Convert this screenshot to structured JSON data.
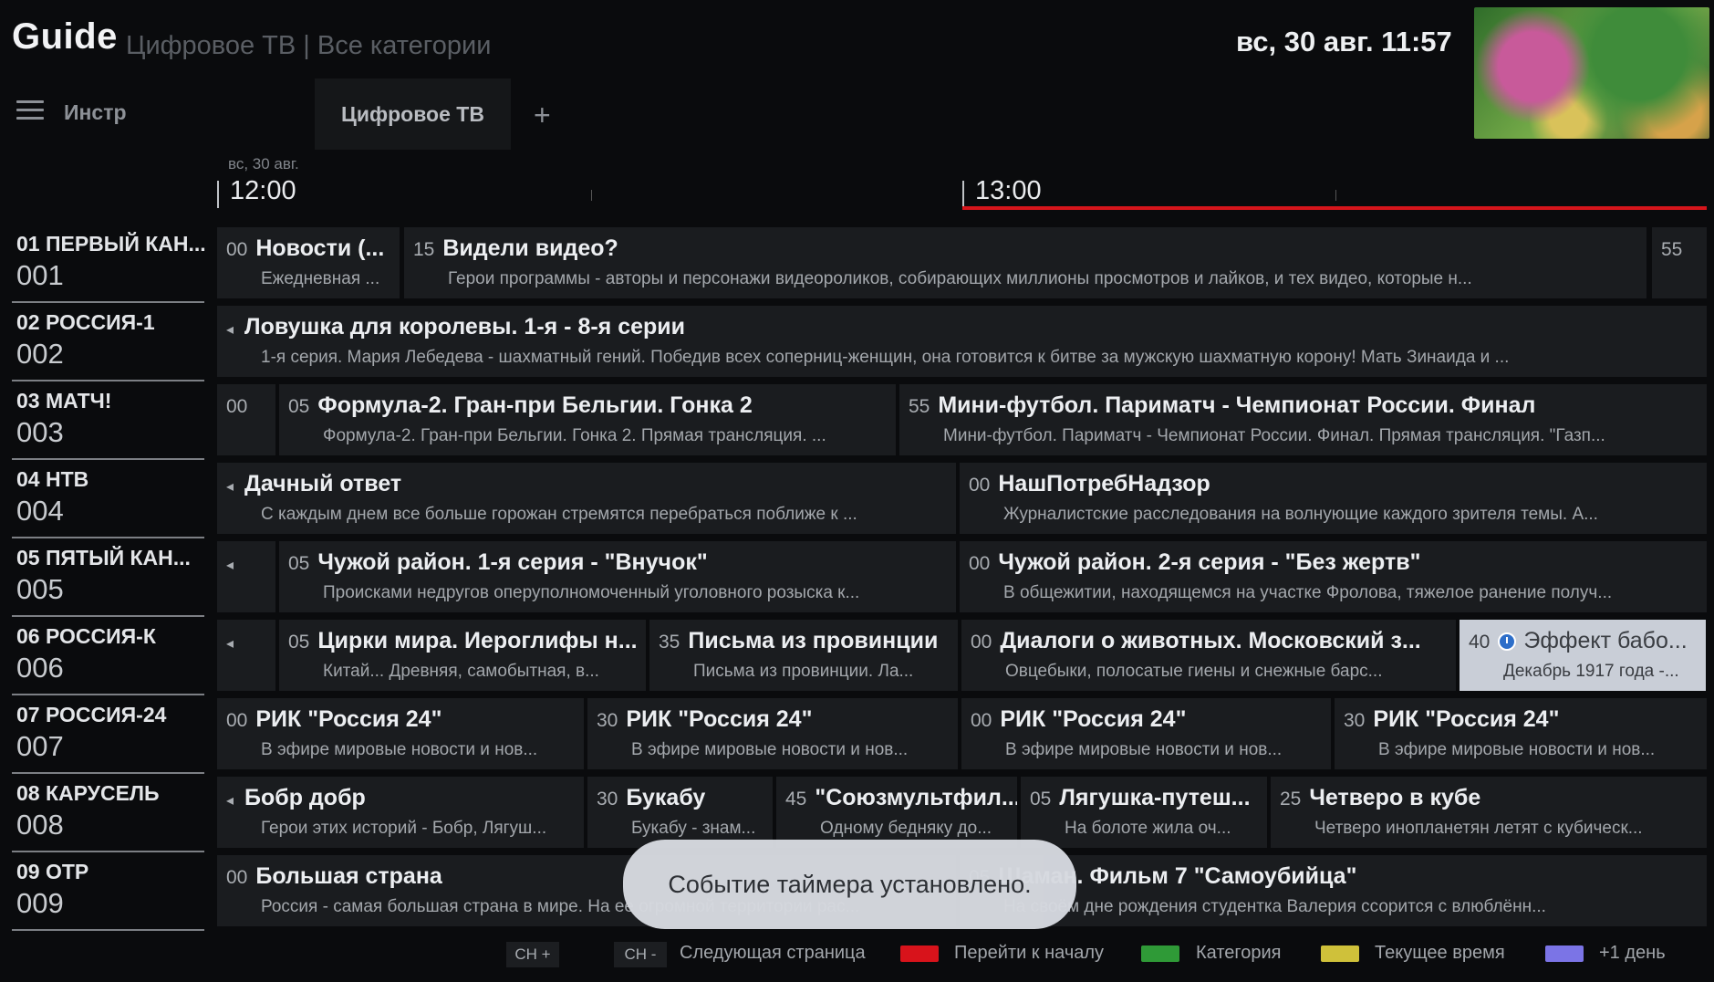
{
  "header": {
    "title": "Guide",
    "subtitle": "Цифровое ТВ | Все категории",
    "datetime": "вс, 30 авг. 11:57"
  },
  "toolbar": {
    "tools_label": "Инстр",
    "tab_label": "Цифровое ТВ",
    "add_label": "+"
  },
  "timeline": {
    "date": "вс, 30 авг.",
    "t1": "12:00",
    "t2": "13:00"
  },
  "channels": [
    {
      "name": "01 ПЕРВЫЙ КАН...",
      "number": "001"
    },
    {
      "name": "02 РОССИЯ-1",
      "number": "002"
    },
    {
      "name": "03 МАТЧ!",
      "number": "003"
    },
    {
      "name": "04 НТВ",
      "number": "004"
    },
    {
      "name": "05 ПЯТЫЙ КАН...",
      "number": "005"
    },
    {
      "name": "06 РОССИЯ-К",
      "number": "006"
    },
    {
      "name": "07 РОССИЯ-24",
      "number": "007"
    },
    {
      "name": "08 КАРУСЕЛЬ",
      "number": "008"
    },
    {
      "name": "09 ОТР",
      "number": "009"
    }
  ],
  "programs": [
    [
      {
        "min": "00",
        "title": "Новости (...",
        "desc": "Ежедневная ..."
      },
      {
        "min": "15",
        "title": "Видели видео?",
        "desc": "Герои программы - авторы и персонажи видеороликов, собирающих миллионы просмотров и лайков, и тех видео, которые н..."
      },
      {
        "min": "55",
        "title": "",
        "desc": ""
      }
    ],
    [
      {
        "arrow": "◂",
        "title": "Ловушка для королевы. 1-я - 8-я серии",
        "desc": "1-я серия. Мария Лебедева - шахматный гений. Победив всех соперниц-женщин, она готовится к битве за мужскую шахматную корону! Мать Зинаида и ..."
      }
    ],
    [
      {
        "min": "00",
        "title": "",
        "desc": ""
      },
      {
        "min": "05",
        "title": "Формула-2. Гран-при Бельгии. Гонка 2",
        "desc": "Формула-2. Гран-при Бельгии. Гонка 2. Прямая трансляция. ..."
      },
      {
        "min": "55",
        "title": "Мини-футбол. Париматч - Чемпионат России. Финал",
        "desc": "Мини-футбол. Париматч - Чемпионат России. Финал. Прямая трансляция. \"Газп..."
      }
    ],
    [
      {
        "arrow": "◂",
        "title": "Дачный ответ",
        "desc": "С каждым днем все больше горожан стремятся перебраться поближе к ..."
      },
      {
        "min": "00",
        "title": "НашПотребНадзор",
        "desc": "Журналистские расследования на волнующие каждого зрителя темы. А..."
      }
    ],
    [
      {
        "arrow": "◂",
        "title": "",
        "desc": ""
      },
      {
        "min": "05",
        "title": "Чужой район. 1-я серия - \"Внучок\"",
        "desc": "Происками недругов оперуполномоченный уголовного розыска к..."
      },
      {
        "min": "00",
        "title": "Чужой район. 2-я серия - \"Без жертв\"",
        "desc": "В общежитии, находящемся на участке Фролова, тяжелое ранение получ..."
      }
    ],
    [
      {
        "arrow": "◂",
        "title": "",
        "desc": ""
      },
      {
        "min": "05",
        "title": "Цирки мира. Иероглифы н...",
        "desc": "Китай... Древняя, самобытная, в..."
      },
      {
        "min": "35",
        "title": "Письма из провинции",
        "desc": "Письма из провинции. Ла..."
      },
      {
        "min": "00",
        "title": "Диалоги о животных. Московский з...",
        "desc": "Овцебыки, полосатые гиены и снежные барс..."
      },
      {
        "min": "40",
        "title": "Эффект бабо...",
        "desc": "Декабрь 1917 года -..."
      }
    ],
    [
      {
        "min": "00",
        "title": "РИК \"Россия 24\"",
        "desc": "В эфире мировые новости и нов..."
      },
      {
        "min": "30",
        "title": "РИК \"Россия 24\"",
        "desc": "В эфире мировые новости и нов..."
      },
      {
        "min": "00",
        "title": "РИК \"Россия 24\"",
        "desc": "В эфире мировые новости и нов..."
      },
      {
        "min": "30",
        "title": "РИК \"Россия 24\"",
        "desc": "В эфире мировые новости и нов..."
      }
    ],
    [
      {
        "arrow": "◂",
        "title": "Бобр добр",
        "desc": "Герои этих историй - Бобр, Лягуш..."
      },
      {
        "min": "30",
        "title": "Букабу",
        "desc": "Букабу - знам..."
      },
      {
        "min": "45",
        "title": "\"Союзмультфил...",
        "desc": "Одному бедняку до..."
      },
      {
        "min": "05",
        "title": "Лягушка-путеш...",
        "desc": "На болоте жила оч..."
      },
      {
        "min": "25",
        "title": "Четверо в кубе",
        "desc": "Четверо инопланетян летят с кубическ..."
      }
    ],
    [
      {
        "min": "00",
        "title": "Большая страна",
        "desc": "Россия - самая большая страна в мире. На ее огромной территории рас..."
      },
      {
        "min": "05",
        "title": "Шаман. Фильм 7 \"Самоубийца\"",
        "desc": "На своём дне рождения студентка Валерия ссорится с влюблённ..."
      }
    ]
  ],
  "toast": "Событие таймера установлено.",
  "footer": {
    "ch_plus": "CH +",
    "ch_minus": "CH -",
    "next_page": "Следующая страница",
    "go_start": "Перейти к началу",
    "category": "Категория",
    "current_time": "Текущее время",
    "plus_day": "+1 день",
    "colors": {
      "red": "#d8131b",
      "green": "#2f9a37",
      "yellow": "#cfc13a",
      "blue": "#7b74e6"
    }
  }
}
